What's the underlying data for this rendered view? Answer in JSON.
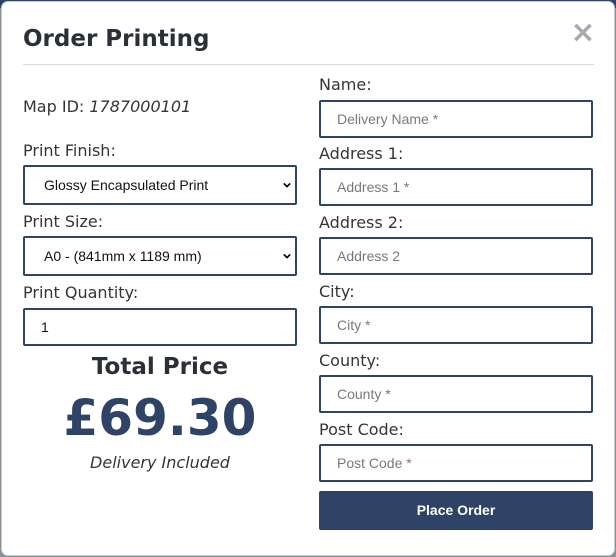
{
  "dialog": {
    "title": "Order Printing",
    "close_symbol": "×"
  },
  "map": {
    "id_label": "Map ID:",
    "id_value": "1787000101"
  },
  "print_finish": {
    "label": "Print Finish:",
    "selected": "Glossy Encapsulated Print"
  },
  "print_size": {
    "label": "Print Size:",
    "selected": "A0 - (841mm x 1189 mm)"
  },
  "print_quantity": {
    "label": "Print Quantity:",
    "value": "1"
  },
  "pricing": {
    "total_label": "Total Price",
    "price": "£69.30",
    "note": "Delivery Included"
  },
  "delivery": {
    "name": {
      "label": "Name:",
      "placeholder": "Delivery Name *",
      "value": ""
    },
    "address1": {
      "label": "Address 1:",
      "placeholder": "Address 1 *",
      "value": ""
    },
    "address2": {
      "label": "Address 2:",
      "placeholder": "Address 2",
      "value": ""
    },
    "city": {
      "label": "City:",
      "placeholder": "City *",
      "value": ""
    },
    "county": {
      "label": "County:",
      "placeholder": "County *",
      "value": ""
    },
    "postcode": {
      "label": "Post Code:",
      "placeholder": "Post Code *",
      "value": ""
    }
  },
  "actions": {
    "place_order": "Place Order"
  },
  "colors": {
    "accent": "#2e4365",
    "text": "#333638",
    "close_icon": "#a7aaae"
  },
  "icons": {
    "close": "close-icon",
    "dropdown": "chevron-down-icon"
  }
}
